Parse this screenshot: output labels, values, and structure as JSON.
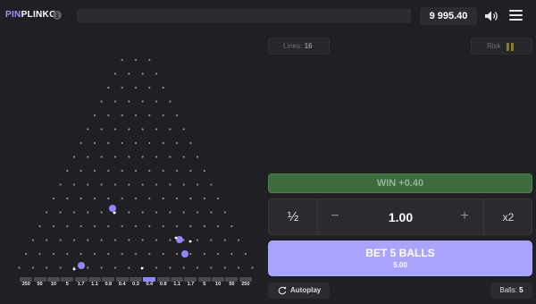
{
  "header": {
    "logo_part1": "PIN",
    "logo_part2": "PLINKO",
    "info_icon": "info-icon",
    "balance": "9 995.40",
    "sound_icon": "speaker-icon",
    "menu_icon": "hamburger-menu-icon"
  },
  "board": {
    "rows": 16,
    "multipliers": [
      "250",
      "50",
      "10",
      "5",
      "1.7",
      "1.1",
      "0.8",
      "0.4",
      "0.3",
      "0.4",
      "0.8",
      "1.1",
      "1.7",
      "5",
      "10",
      "50",
      "250"
    ],
    "highlighted_slot": 9,
    "peg_color": "#8a8b93",
    "ball_color": "#8f87ff"
  },
  "controls": {
    "lines_label": "Lines:",
    "lines_value": "16",
    "risk_label": "Risk",
    "risk_icon": "risk-level-bars-icon",
    "win_text": "WIN +0.40",
    "half_label": "½",
    "minus_label": "−",
    "stake_value": "1.00",
    "plus_label": "+",
    "double_label": "x2",
    "bet_label": "BET 5 BALLS",
    "bet_amount": "5.00",
    "autoplay_label": "Autoplay",
    "autoplay_icon": "autoplay-icon",
    "balls_label": "Balls:",
    "balls_value": "5"
  },
  "colors": {
    "accent": "#a9a4ff",
    "win_green": "#3c6b3d",
    "background": "#1f2024"
  }
}
